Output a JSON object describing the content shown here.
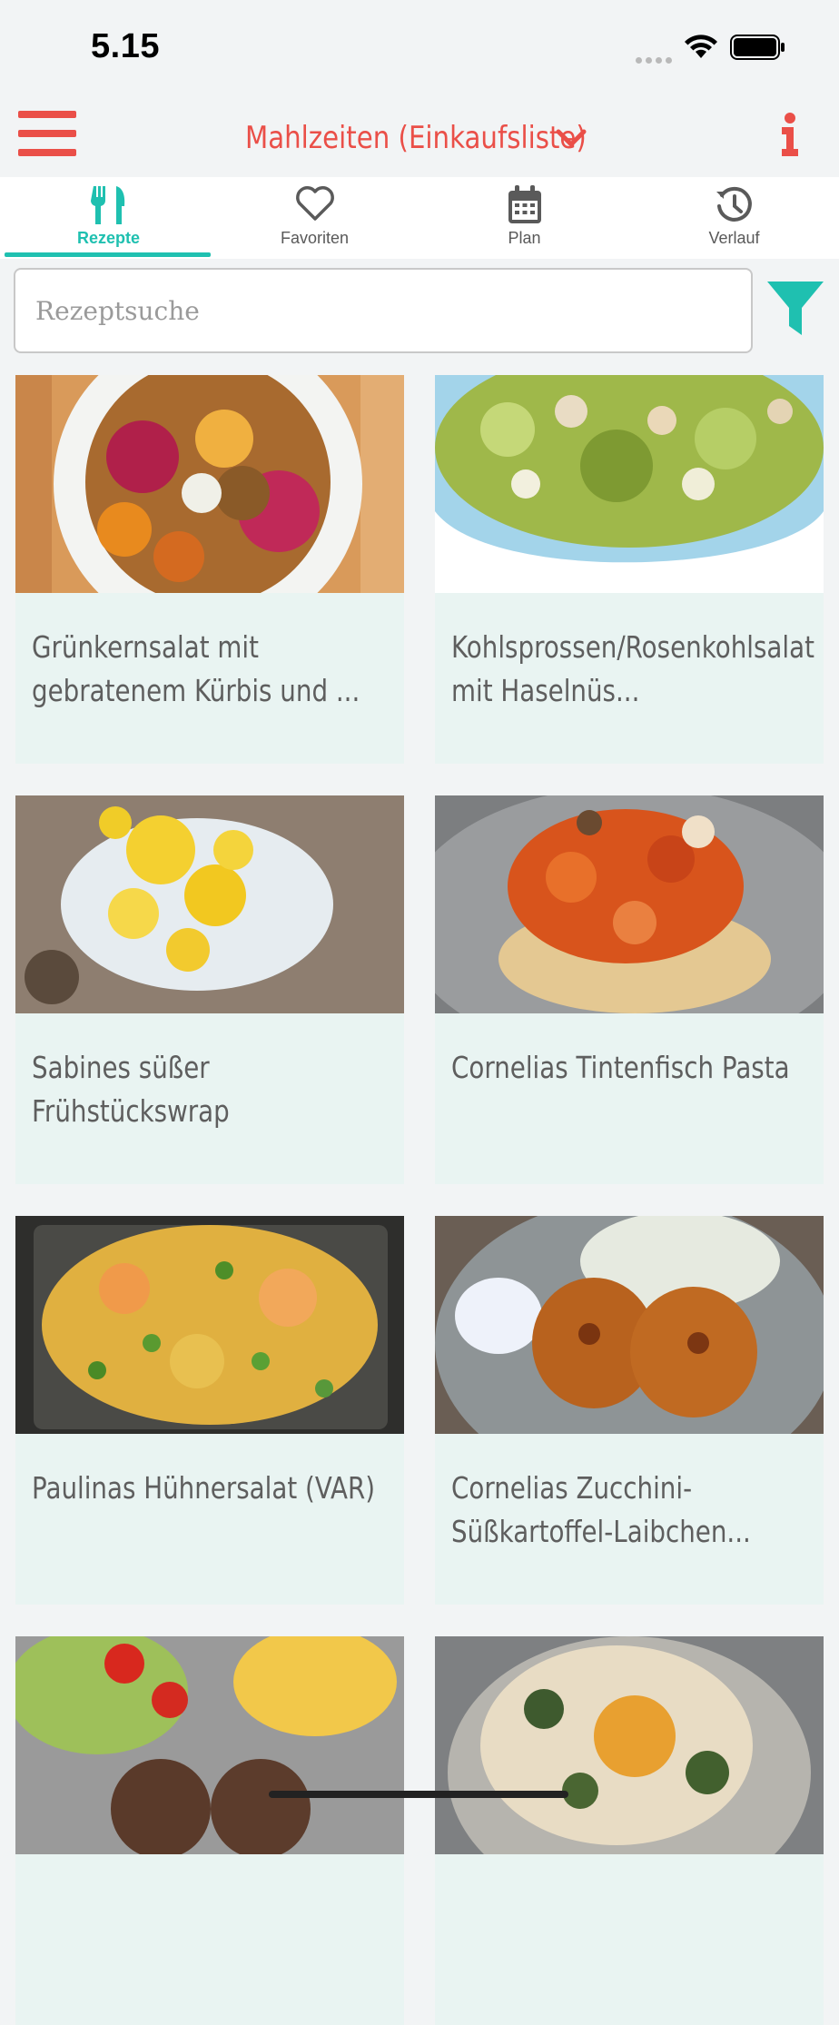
{
  "status": {
    "time": "5.15"
  },
  "header": {
    "title": "Mahlzeiten (Einkaufsliste)"
  },
  "tabs": [
    {
      "label": "Rezepte",
      "icon": "fork-knife-icon",
      "active": true
    },
    {
      "label": "Favoriten",
      "icon": "heart-icon",
      "active": false
    },
    {
      "label": "Plan",
      "icon": "calendar-icon",
      "active": false
    },
    {
      "label": "Verlauf",
      "icon": "history-icon",
      "active": false
    }
  ],
  "search": {
    "placeholder": "Rezeptsuche",
    "value": ""
  },
  "colors": {
    "accent": "#ea4f48",
    "teal": "#1fc0b0",
    "card_bg": "#e9f4f2",
    "page_bg": "#f2f4f5"
  },
  "recipes": [
    {
      "title": "Grünkernsalat mit gebratenem Kürbis und ..."
    },
    {
      "title": "Kohlsprossen/Rosenkohlsalat mit Haselnüs..."
    },
    {
      "title": "Sabines süßer Frühstückswrap"
    },
    {
      "title": "Cornelias Tintenfisch Pasta"
    },
    {
      "title": "Paulinas Hühnersalat (VAR)"
    },
    {
      "title": "Cornelias Zucchini-Süßkartoffel-Laibchen..."
    },
    {
      "title": ""
    },
    {
      "title": ""
    }
  ]
}
